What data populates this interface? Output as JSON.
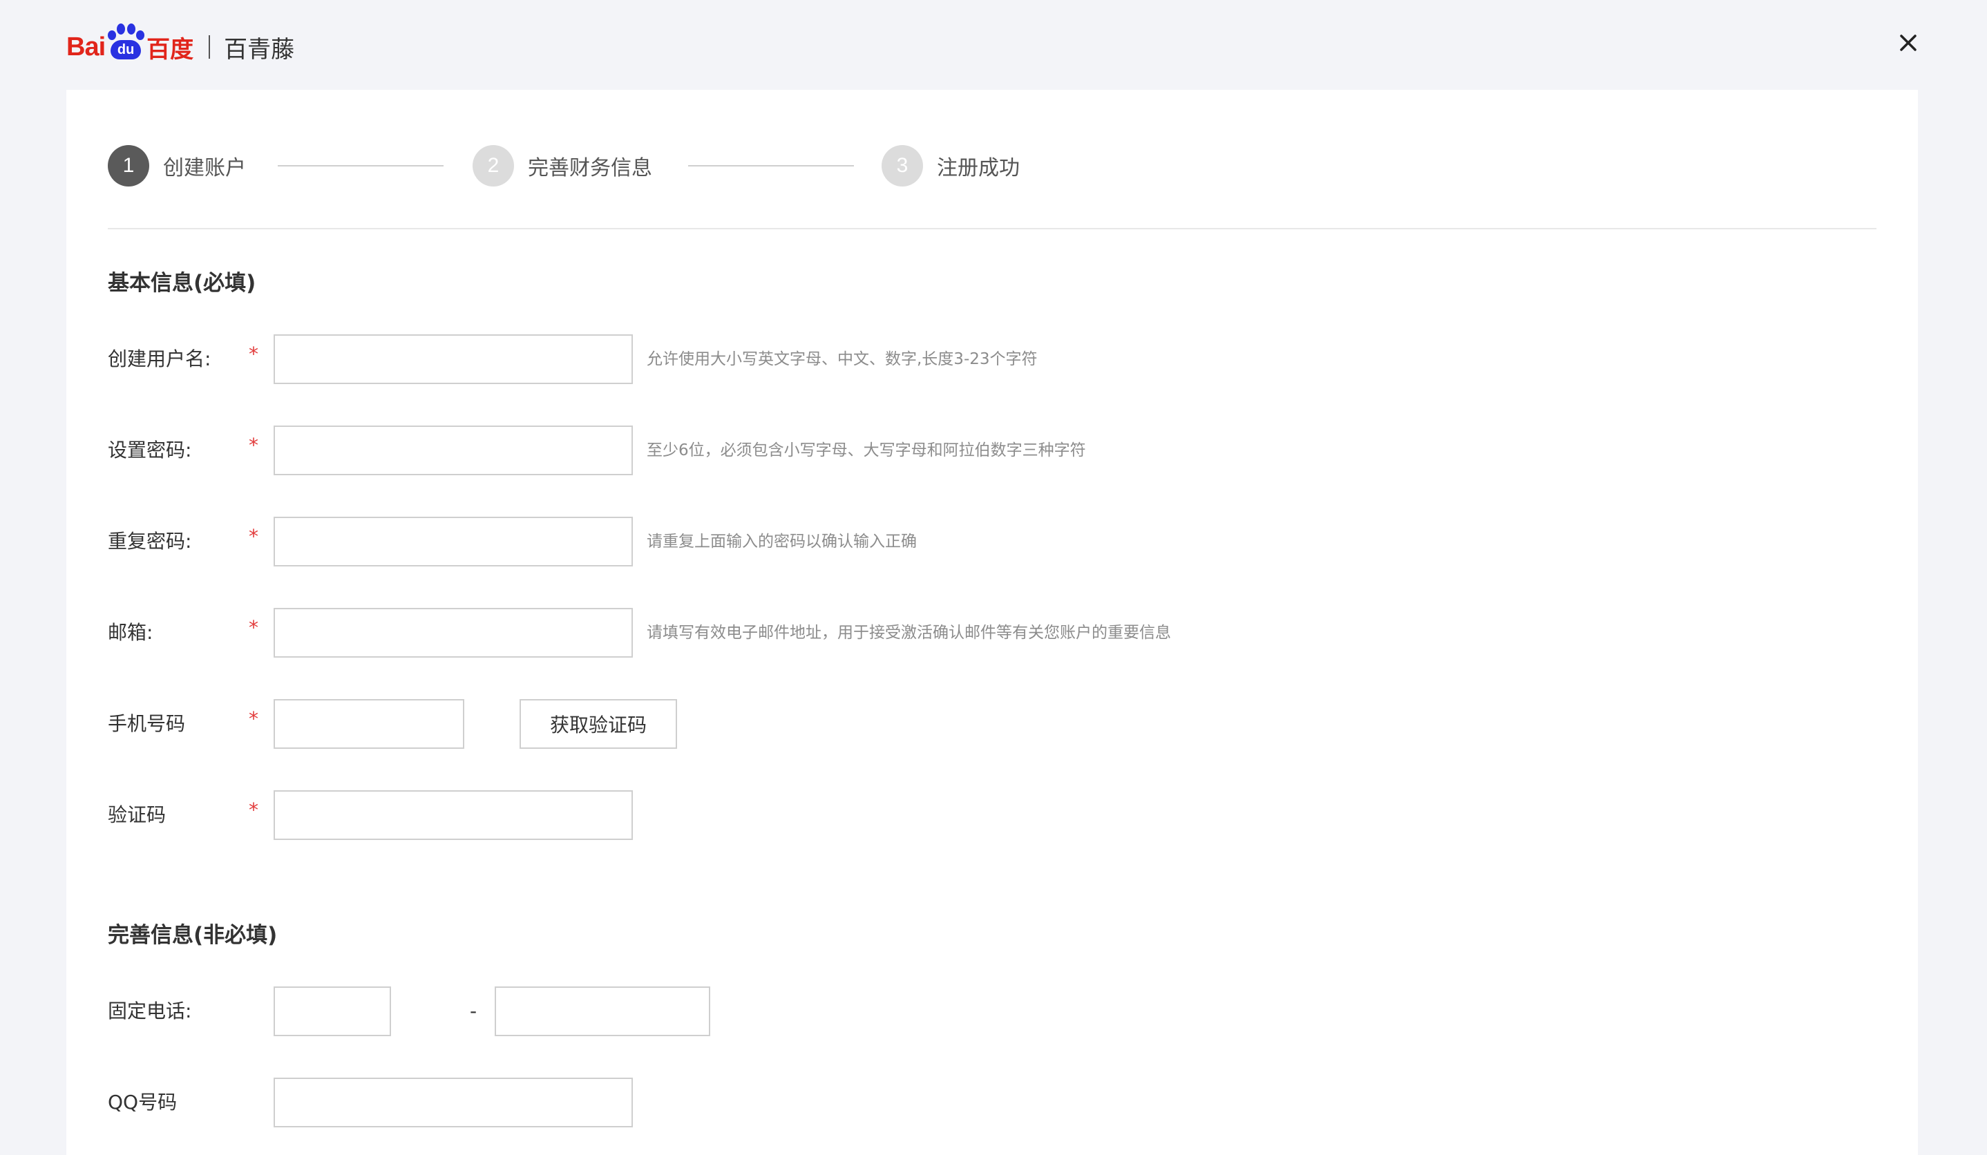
{
  "header": {
    "logo_bai": "Bai",
    "logo_du_pad": "du",
    "logo_du": "百度",
    "product_name": "百青藤",
    "close_icon": "close-icon"
  },
  "stepper": {
    "steps": [
      {
        "number": "1",
        "label": "创建账户",
        "state": "active"
      },
      {
        "number": "2",
        "label": "完善财务信息",
        "state": "inactive"
      },
      {
        "number": "3",
        "label": "注册成功",
        "state": "inactive"
      }
    ]
  },
  "basic_section": {
    "title": "基本信息(必填)",
    "required_mark": "*",
    "fields": [
      {
        "label": "创建用户名:",
        "value": "",
        "hint": "允许使用大小写英文字母、中文、数字,长度3-23个字符"
      },
      {
        "label": "设置密码:",
        "value": "",
        "hint": "至少6位，必须包含小写字母、大写字母和阿拉伯数字三种字符"
      },
      {
        "label": "重复密码:",
        "value": "",
        "hint": "请重复上面输入的密码以确认输入正确"
      },
      {
        "label": "邮箱:",
        "value": "",
        "hint": "请填写有效电子邮件地址，用于接受激活确认邮件等有关您账户的重要信息"
      },
      {
        "label": "手机号码",
        "value": "",
        "button_label": "获取验证码"
      },
      {
        "label": "验证码",
        "value": ""
      }
    ]
  },
  "optional_section": {
    "title": "完善信息(非必填)",
    "landline": {
      "label": "固定电话:",
      "area_code": "",
      "number": "",
      "separator": "-"
    },
    "qq": {
      "label": "QQ号码",
      "value": ""
    }
  },
  "colors": {
    "page_bg": "#f3f4f8",
    "card_bg": "#ffffff",
    "brand_red": "#e1251b",
    "brand_blue": "#2932e1",
    "active_step": "#5a5a5a",
    "inactive_step": "#dcdcdc",
    "required": "#e23c3c",
    "hint_text": "#8c8c8c",
    "input_border": "#cfcfcf"
  }
}
